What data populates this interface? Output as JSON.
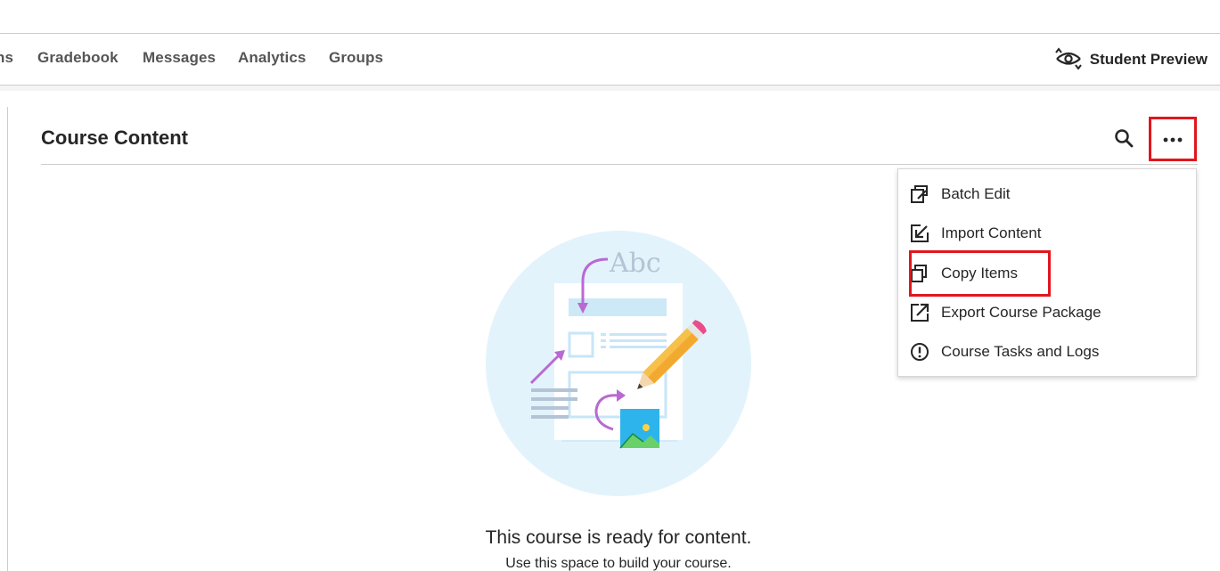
{
  "nav": {
    "tabs": [
      {
        "label": "ns"
      },
      {
        "label": "Gradebook"
      },
      {
        "label": "Messages"
      },
      {
        "label": "Analytics"
      },
      {
        "label": "Groups"
      }
    ],
    "student_preview_label": "Student Preview"
  },
  "content": {
    "title": "Course Content",
    "search_icon": "search-icon",
    "more_icon": "more-options-icon"
  },
  "menu": {
    "items": [
      {
        "label": "Batch Edit",
        "icon": "batch-edit-icon"
      },
      {
        "label": "Import Content",
        "icon": "import-content-icon"
      },
      {
        "label": "Copy Items",
        "icon": "copy-items-icon"
      },
      {
        "label": "Export Course Package",
        "icon": "export-icon"
      },
      {
        "label": "Course Tasks and Logs",
        "icon": "alert-icon"
      }
    ]
  },
  "empty_state": {
    "illustration_text": "Abc",
    "title": "This course is ready for content.",
    "subtitle": "Use this space to build your course."
  },
  "colors": {
    "highlight": "#e0161e",
    "illustration_bg": "#e3f3fc",
    "arrow": "#b86ad1"
  }
}
